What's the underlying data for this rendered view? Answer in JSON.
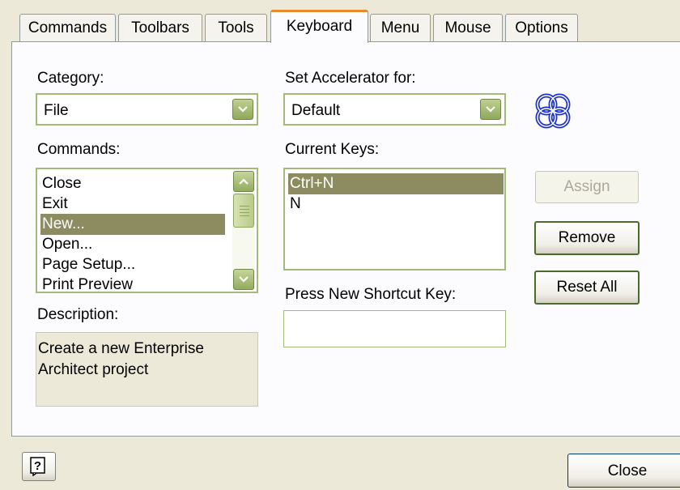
{
  "tabs": [
    {
      "label": "Commands"
    },
    {
      "label": "Toolbars"
    },
    {
      "label": "Tools"
    },
    {
      "label": "Keyboard"
    },
    {
      "label": "Menu"
    },
    {
      "label": "Mouse"
    },
    {
      "label": "Options"
    }
  ],
  "active_tab": "Keyboard",
  "category": {
    "label": "Category:",
    "value": "File"
  },
  "accelerator": {
    "label": "Set Accelerator for:",
    "value": "Default"
  },
  "commands": {
    "label": "Commands:",
    "items": [
      "Close",
      "Exit",
      "New...",
      "Open...",
      "Page Setup...",
      "Print Preview"
    ],
    "selected": "New..."
  },
  "current_keys": {
    "label": "Current Keys:",
    "items": [
      "Ctrl+N",
      "N"
    ],
    "selected": "Ctrl+N"
  },
  "shortcut": {
    "label": "Press New Shortcut Key:",
    "value": ""
  },
  "description": {
    "label": "Description:",
    "lines": [
      "Create a new Enterprise",
      "Architect project"
    ]
  },
  "buttons": {
    "assign": "Assign",
    "remove": "Remove",
    "reset_all": "Reset All",
    "close": "Close"
  },
  "icons": {
    "logo": "enterprise-architect-logo-icon",
    "help": "help-icon"
  },
  "colors": {
    "selection": "#8C8C60",
    "active_tab_accent": "#E68B2C",
    "logo": "#1D33C8"
  }
}
